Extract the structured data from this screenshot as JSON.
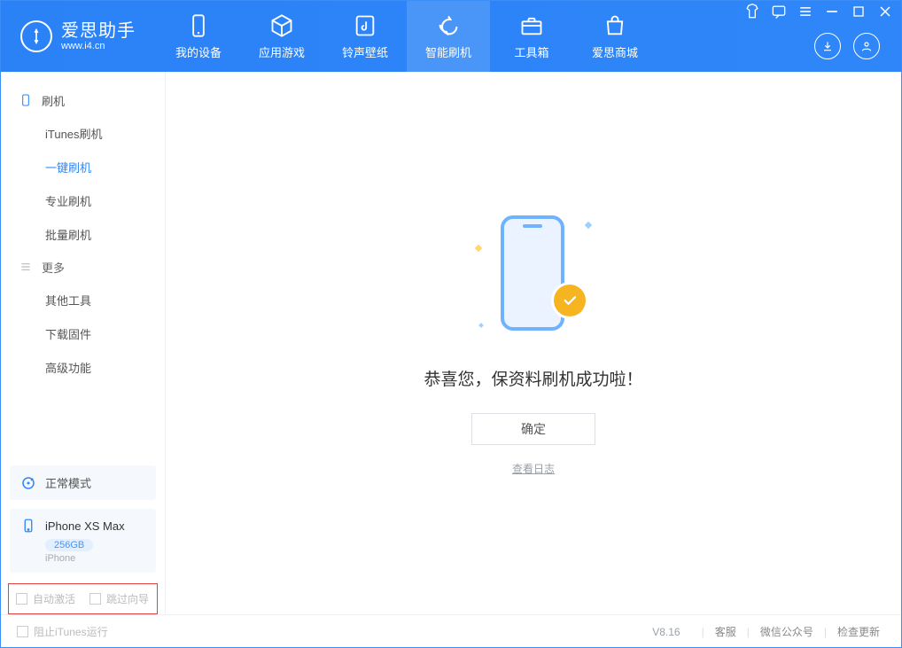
{
  "app": {
    "name_cn": "爱思助手",
    "url": "www.i4.cn"
  },
  "nav": {
    "items": [
      {
        "label": "我的设备",
        "icon": "device"
      },
      {
        "label": "应用游戏",
        "icon": "cube"
      },
      {
        "label": "铃声壁纸",
        "icon": "music"
      },
      {
        "label": "智能刷机",
        "icon": "refresh",
        "active": true
      },
      {
        "label": "工具箱",
        "icon": "toolbox"
      },
      {
        "label": "爱思商城",
        "icon": "bag"
      }
    ]
  },
  "sidebar": {
    "section1": {
      "title": "刷机",
      "items": [
        {
          "label": "iTunes刷机"
        },
        {
          "label": "一键刷机",
          "active": true
        },
        {
          "label": "专业刷机"
        },
        {
          "label": "批量刷机"
        }
      ]
    },
    "section2": {
      "title": "更多",
      "items": [
        {
          "label": "其他工具"
        },
        {
          "label": "下载固件"
        },
        {
          "label": "高级功能"
        }
      ]
    },
    "mode": {
      "label": "正常模式"
    },
    "device": {
      "name": "iPhone XS Max",
      "capacity": "256GB",
      "type": "iPhone"
    },
    "options": {
      "auto_activate": "自动激活",
      "skip_guide": "跳过向导"
    }
  },
  "main": {
    "success_text": "恭喜您，保资料刷机成功啦！",
    "ok_button": "确定",
    "view_log": "查看日志"
  },
  "footer": {
    "block_itunes": "阻止iTunes运行",
    "version": "V8.16",
    "links": [
      "客服",
      "微信公众号",
      "检查更新"
    ]
  }
}
